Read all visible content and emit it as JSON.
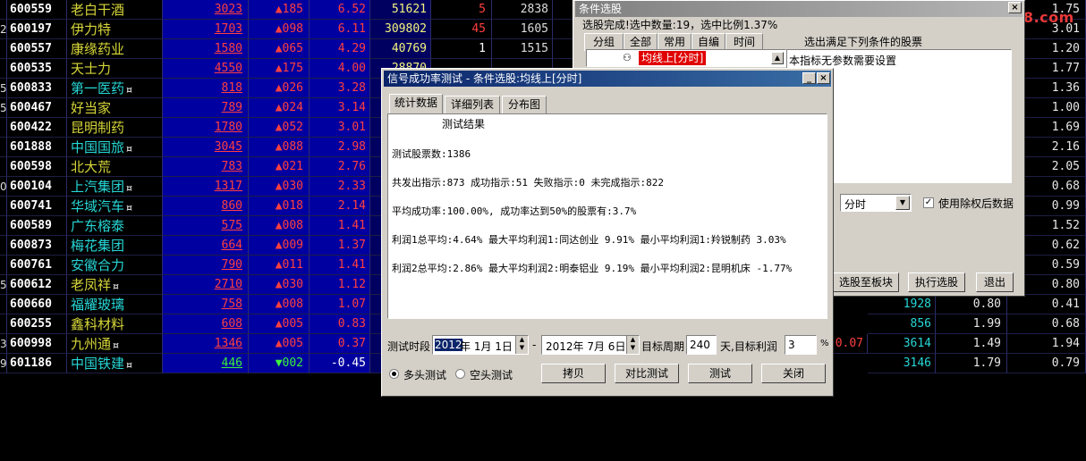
{
  "colors": {
    "up": "#ff3f3f",
    "down": "#3cf03c",
    "name_yellow": "#d6d63a",
    "name_cyan": "#27d7d7",
    "bg": "#000000"
  },
  "stocks": [
    {
      "idx": "",
      "code": "600559",
      "name": "老白干酒",
      "mark": "",
      "price": "3023",
      "chg": "▲185",
      "pct": "6.52",
      "vol": "51621",
      "x1": "5",
      "x2": "2838",
      "x3": "2855",
      "r1": "",
      "r2": "",
      "r3": "1.75"
    },
    {
      "idx": "2",
      "code": "600197",
      "name": "伊力特",
      "mark": "",
      "price": "1703",
      "chg": "▲098",
      "pct": "6.11",
      "vol": "309802",
      "x1": "45",
      "x2": "1605",
      "x3": "1575",
      "r1": "",
      "r2": "",
      "r3": "3.01"
    },
    {
      "idx": "",
      "code": "600557",
      "name": "康缘药业",
      "mark": "",
      "price": "1580",
      "chg": "▲065",
      "pct": "4.29",
      "vol": "40769",
      "x1": "1",
      "x2": "1515",
      "x3": "1510",
      "r1": "",
      "r2": "",
      "r3": "1.20"
    },
    {
      "idx": "",
      "code": "600535",
      "name": "天士力",
      "mark": "",
      "price": "4550",
      "chg": "▲175",
      "pct": "4.00",
      "vol": "28870",
      "x1": "",
      "x2": "",
      "x3": "",
      "r1": "",
      "r2": "",
      "r3": "1.77"
    },
    {
      "idx": "5",
      "code": "600833",
      "name": "第一医药",
      "mark": "¤",
      "price": "818",
      "chg": "▲026",
      "pct": "3.28",
      "vol": "74102",
      "x1": "",
      "x2": "",
      "x3": "",
      "r1": "",
      "r2": "",
      "r3": "1.36"
    },
    {
      "idx": "5",
      "code": "600467",
      "name": "好当家",
      "mark": "",
      "price": "789",
      "chg": "▲024",
      "pct": "3.14",
      "vol": "64296",
      "x1": "",
      "x2": "",
      "x3": "",
      "r1": "",
      "r2": "",
      "r3": "1.00"
    },
    {
      "idx": "",
      "code": "600422",
      "name": "昆明制药",
      "mark": "",
      "price": "1780",
      "chg": "▲052",
      "pct": "3.01",
      "vol": "46474",
      "x1": "",
      "x2": "",
      "x3": "",
      "r1": "",
      "r2": "",
      "r3": "1.69"
    },
    {
      "idx": "",
      "code": "601888",
      "name": "中国国旅",
      "mark": "¤",
      "price": "3045",
      "chg": "▲088",
      "pct": "2.98",
      "vol": "59714",
      "x1": "",
      "x2": "",
      "x3": "",
      "r1": "",
      "r2": "",
      "r3": "2.16"
    },
    {
      "idx": "",
      "code": "600598",
      "name": "北大荒",
      "mark": "",
      "price": "783",
      "chg": "▲021",
      "pct": "2.76",
      "vol": "95459",
      "x1": "",
      "x2": "",
      "x3": "",
      "r1": "",
      "r2": "",
      "r3": "2.05"
    },
    {
      "idx": "0",
      "code": "600104",
      "name": "上汽集团",
      "mark": "¤",
      "price": "1317",
      "chg": "▲030",
      "pct": "2.33",
      "vol": "170351",
      "x1": "",
      "x2": "",
      "x3": "",
      "r1": "",
      "r2": "",
      "r3": "0.68"
    },
    {
      "idx": "",
      "code": "600741",
      "name": "华域汽车",
      "mark": "¤",
      "price": "860",
      "chg": "▲018",
      "pct": "2.14",
      "vol": "70641",
      "x1": "",
      "x2": "",
      "x3": "",
      "r1": "",
      "r2": "",
      "r3": "0.99"
    },
    {
      "idx": "",
      "code": "600589",
      "name": "广东榕泰",
      "mark": "",
      "price": "575",
      "chg": "▲008",
      "pct": "1.41",
      "vol": "26760",
      "x1": "",
      "x2": "",
      "x3": "",
      "r1": "",
      "r2": "",
      "r3": "1.52"
    },
    {
      "idx": "",
      "code": "600873",
      "name": "梅花集团",
      "mark": "",
      "price": "664",
      "chg": "▲009",
      "pct": "1.37",
      "vol": "18572",
      "x1": "",
      "x2": "",
      "x3": "",
      "r1": "",
      "r2": "",
      "r3": "0.62"
    },
    {
      "idx": "",
      "code": "600761",
      "name": "安徽合力",
      "mark": "",
      "price": "790",
      "chg": "▲011",
      "pct": "1.41",
      "vol": "16968",
      "x1": "",
      "x2": "",
      "x3": "",
      "r1": "",
      "r2": "",
      "r3": "0.59"
    },
    {
      "idx": "5",
      "code": "600612",
      "name": "老凤祥",
      "mark": "¤",
      "price": "2710",
      "chg": "▲030",
      "pct": "1.12",
      "vol": "5830",
      "x1": "",
      "x2": "",
      "x3": "",
      "r1": "",
      "r2": "",
      "r3": "0.80"
    },
    {
      "idx": "",
      "code": "600660",
      "name": "福耀玻璃",
      "mark": "",
      "price": "758",
      "chg": "▲008",
      "pct": "1.07",
      "vol": "25484",
      "x1": "",
      "x2": "",
      "x3": "",
      "r1": "1928",
      "r2": "0.80",
      "r3": "0.41"
    },
    {
      "idx": "",
      "code": "600255",
      "name": "鑫科材料",
      "mark": "",
      "price": "608",
      "chg": "▲005",
      "pct": "0.83",
      "vol": "14111",
      "x1": "",
      "x2": "",
      "x3": "",
      "r1": "856",
      "r2": "1.99",
      "r3": "0.68"
    },
    {
      "idx": "3",
      "code": "600998",
      "name": "九州通",
      "mark": "¤",
      "price": "1346",
      "chg": "▲005",
      "pct": "0.37",
      "vol": "26919",
      "x1": "",
      "x2": "",
      "x3": "",
      "r1": "3614",
      "r2": "1.49",
      "r3": "1.94",
      "mid": "0.07"
    },
    {
      "idx": "9",
      "code": "601186",
      "name": "中国铁建",
      "mark": "¤",
      "price": "446",
      "chg": "▼002",
      "pct": "-0.45",
      "vol": "70767",
      "x1": "",
      "x2": "",
      "x3": "",
      "r1": "3146",
      "r2": "1.79",
      "r3": "0.79"
    }
  ],
  "logo": {
    "text": "www.55188.com"
  },
  "cond": {
    "title": "条件选股",
    "status": "选股完成!选中数量:19，选中比例1.37%",
    "tabs": [
      "分组",
      "全部",
      "常用",
      "自编",
      "时间"
    ],
    "header": "选出满足下列条件的股票",
    "selected_item": "均线上[分时]",
    "param_note": "本指标无参数需要设置",
    "period": "分时",
    "adjust_label": "使用除权后数据",
    "btn_to_block": "选股至板块",
    "btn_run": "执行选股",
    "btn_exit": "退出"
  },
  "sig": {
    "title": "信号成功率测试 - 条件选股:均线上[分时]",
    "tabs": [
      "统计数据",
      "详细列表",
      "分布图"
    ],
    "result_title": "测试结果",
    "lines": [
      "测试股票数:1386",
      "共发出指示:873 成功指示:51 失败指示:0 未完成指示:822",
      "平均成功率:100.00%, 成功率达到50%的股票有:3.7%",
      "利润1总平均:4.64% 最大平均利润1:同达创业 9.91% 最小平均利润1:羚锐制药 3.03%",
      "利润2总平均:2.86% 最大平均利润2:明泰铝业 9.19% 最小平均利润2:昆明机床 -1.77%"
    ],
    "period_label": "测试时段",
    "start_year": "2012",
    "start_rest": "年 1月 1日",
    "dash": "-",
    "end_date": "2012年 7月 6日",
    "cycle_label": "目标周期",
    "cycle_value": "240",
    "cycle_unit": "天,目标利润",
    "profit_value": "3",
    "pct_sign": "%",
    "radio_long": "多头测试",
    "radio_short": "空头测试",
    "btn_copy": "拷贝",
    "btn_compare": "对比测试",
    "btn_test": "测试",
    "btn_close": "关闭"
  }
}
